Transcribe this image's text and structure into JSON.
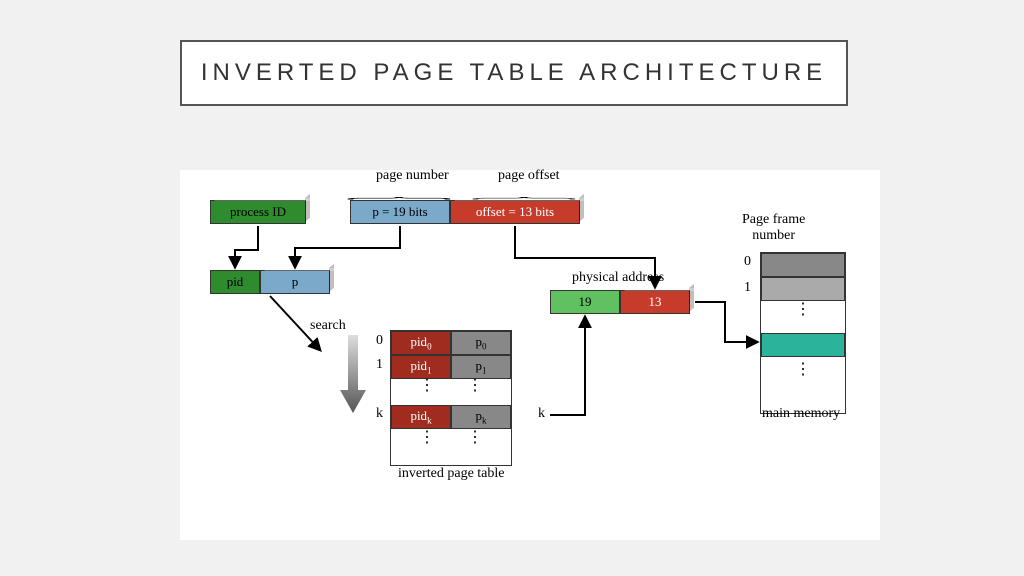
{
  "title": "INVERTED PAGE TABLE ARCHITECTURE",
  "top_labels": {
    "page_number": "page number",
    "page_offset": "page offset"
  },
  "logical_address": {
    "process_id": "process ID",
    "p_bits": "p = 19 bits",
    "offset_bits": "offset = 13 bits"
  },
  "entry": {
    "pid": "pid",
    "p": "p"
  },
  "search_label": "search",
  "ipt": {
    "caption": "inverted page table",
    "indices": [
      "0",
      "1",
      "k"
    ],
    "rows": [
      {
        "pid": "pid",
        "pid_sub": "0",
        "p": "p",
        "p_sub": "0"
      },
      {
        "pid": "pid",
        "pid_sub": "1",
        "p": "p",
        "p_sub": "1"
      },
      {
        "pid": "pid",
        "pid_sub": "k",
        "p": "p",
        "p_sub": "k"
      }
    ]
  },
  "k_label": "k",
  "physical_address_label": "physical address",
  "physical_address": {
    "frame": "19",
    "offset": "13"
  },
  "memory": {
    "caption": "main memory",
    "header": "Page frame\nnumber",
    "indices": [
      "0",
      "1"
    ]
  }
}
